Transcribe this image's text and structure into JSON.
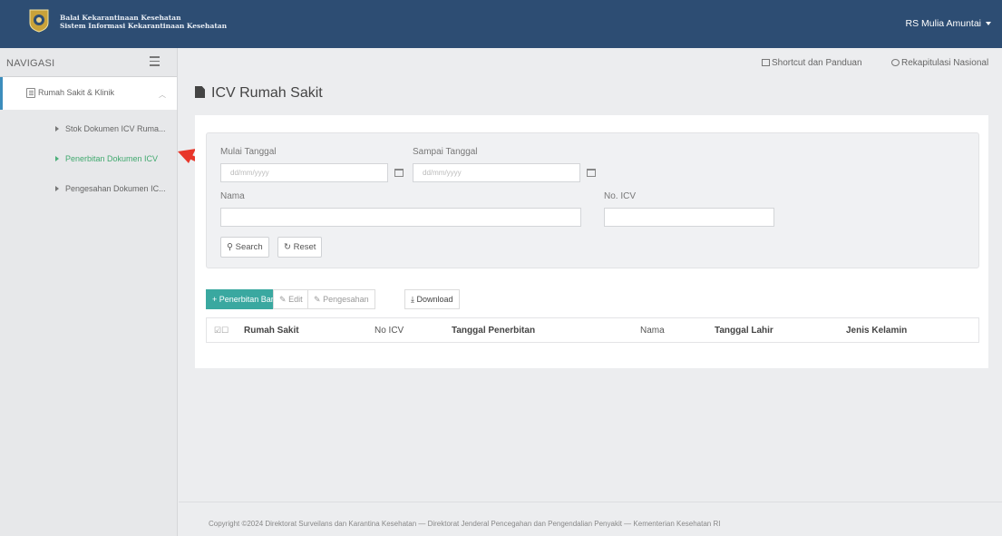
{
  "header": {
    "brand_line1": "Balai Kekarantinaan Kesehatan",
    "brand_line2": "Sistem Informasi Kekarantinaan Kesehatan",
    "user": "RS Mulia Amuntai"
  },
  "sidebar": {
    "title": "NAVIGASI",
    "group_label": "Rumah Sakit & Klinik",
    "items": [
      {
        "label": "Stok Dokumen ICV Ruma..."
      },
      {
        "label": "Penerbitan Dokumen ICV"
      },
      {
        "label": "Pengesahan Dokumen IC..."
      }
    ]
  },
  "topnav": {
    "shortcut": "Shortcut dan Panduan",
    "rekap": "Rekapitulasi Nasional"
  },
  "page": {
    "title": "ICV Rumah Sakit"
  },
  "filter": {
    "mulai_label": "Mulai Tanggal",
    "mulai_placeholder": "dd/mm/yyyy",
    "sampai_label": "Sampai Tanggal",
    "sampai_placeholder": "dd/mm/yyyy",
    "nama_label": "Nama",
    "noicv_label": "No. ICV",
    "search_label": "Search",
    "reset_label": "Reset"
  },
  "toolbar": {
    "new_label": "+ Penerbitan Baru",
    "edit_label": "Edit",
    "pengesahan_label": "Pengesahan",
    "download_label": "Download"
  },
  "table": {
    "columns": [
      "Rumah Sakit",
      "No ICV",
      "Tanggal Penerbitan",
      "Nama",
      "Tanggal Lahir",
      "Jenis Kelamin"
    ]
  },
  "footer": {
    "text": "Copyright ©2024 Direktorat Surveilans dan Karantina Kesehatan — Direktorat Jenderal Pencegahan dan Pengendalian Penyakit — Kementerian Kesehatan RI"
  },
  "colors": {
    "topbar": "#2d4d73",
    "accent": "#3aa8a0",
    "active": "#41a96f",
    "arrow": "#e8362a"
  }
}
